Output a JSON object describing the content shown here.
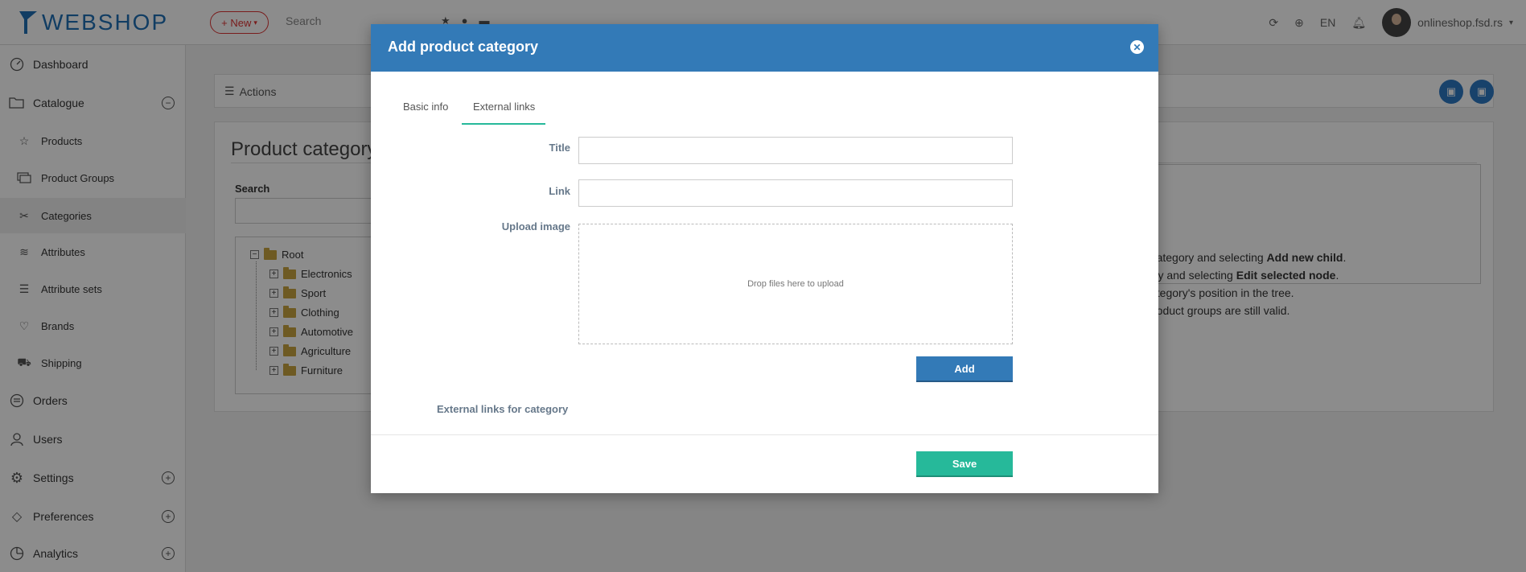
{
  "app": {
    "logo_text": "WEBSHOP",
    "brand_color": "#1f6fb5"
  },
  "topbar": {
    "new_label": "+ New",
    "search_placeholder": "Search",
    "language": "EN",
    "user_name": "onlineshop.fsd.rs"
  },
  "sidebar": {
    "items": [
      {
        "label": "Dashboard",
        "icon": "speedometer-icon"
      },
      {
        "label": "Catalogue",
        "icon": "folder-open-icon"
      },
      {
        "label": "Products",
        "icon": "star-icon"
      },
      {
        "label": "Product Groups",
        "icon": "layers-icon"
      },
      {
        "label": "Categories",
        "icon": "category-icon"
      },
      {
        "label": "Attributes",
        "icon": "stack-icon"
      },
      {
        "label": "Attribute sets",
        "icon": "list-icon"
      },
      {
        "label": "Brands",
        "icon": "heart-icon"
      },
      {
        "label": "Shipping",
        "icon": "shipping-icon"
      },
      {
        "label": "Orders",
        "icon": "orders-icon"
      },
      {
        "label": "Users",
        "icon": "user-icon"
      },
      {
        "label": "Settings",
        "icon": "gear-icon"
      },
      {
        "label": "Preferences",
        "icon": "diamond-icon"
      },
      {
        "label": "Analytics",
        "icon": "pie-chart-icon"
      }
    ]
  },
  "main": {
    "actions_label": "Actions",
    "page_title": "Product category",
    "search_label": "Search",
    "tree": {
      "root": "Root",
      "children": [
        "Electronics",
        "Sport",
        "Clothing",
        "Automotive",
        "Agriculture",
        "Furniture"
      ]
    },
    "help": {
      "line1_prefix": "nt category and selecting ",
      "line1_bold": "Add new child",
      "line1_suffix": ".",
      "line2_prefix": "ory and selecting ",
      "line2_bold": "Edit selected node",
      "line2_suffix": ".",
      "line3": "ategory's position in the tree.",
      "line4": "roduct groups are still valid."
    }
  },
  "modal": {
    "title": "Add product category",
    "tabs": [
      "Basic info",
      "External links"
    ],
    "active_tab": "External links",
    "title_label": "Title",
    "title_value": "",
    "link_label": "Link",
    "link_value": "",
    "upload_label": "Upload image",
    "dropzone_text": "Drop files here to upload",
    "add_button": "Add",
    "links_section_label": "External links for category",
    "save_button": "Save",
    "header_color": "#337ab7",
    "save_color": "#26b99a"
  }
}
